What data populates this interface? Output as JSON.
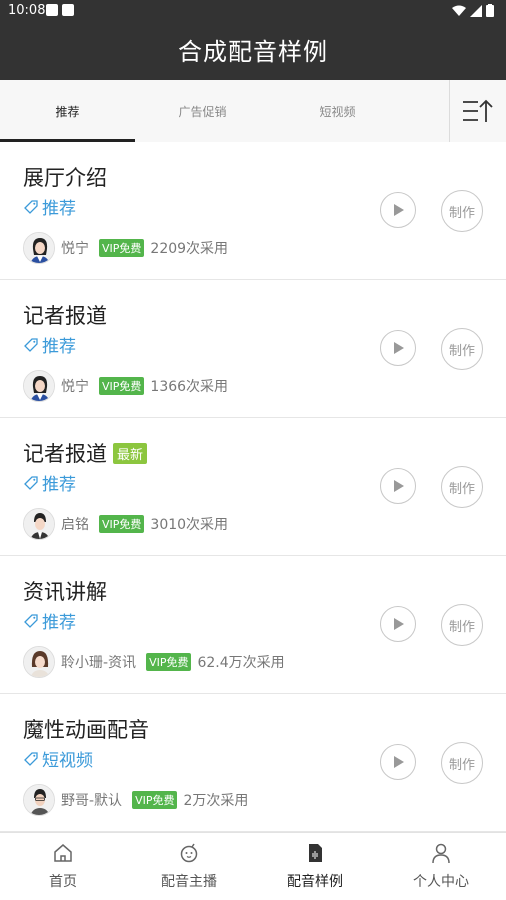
{
  "status_bar": {
    "time": "10:08"
  },
  "header": {
    "title": "合成配音样例"
  },
  "tabs": [
    {
      "label": "推荐",
      "active": true
    },
    {
      "label": "广告促销",
      "active": false
    },
    {
      "label": "短视频",
      "active": false
    }
  ],
  "items": [
    {
      "title": "展厅介绍",
      "badge": "",
      "tag": "推荐",
      "voice": "悦宁",
      "vip": "VIP免费",
      "usage": "2209次采用",
      "make_label": "制作",
      "avatar": "female-avatar"
    },
    {
      "title": "记者报道",
      "badge": "",
      "tag": "推荐",
      "voice": "悦宁",
      "vip": "VIP免费",
      "usage": "1366次采用",
      "make_label": "制作",
      "avatar": "female-avatar"
    },
    {
      "title": "记者报道",
      "badge": "最新",
      "tag": "推荐",
      "voice": "启铭",
      "vip": "VIP免费",
      "usage": "3010次采用",
      "make_label": "制作",
      "avatar": "male-avatar"
    },
    {
      "title": "资讯讲解",
      "badge": "",
      "tag": "推荐",
      "voice": "聆小珊-资讯",
      "vip": "VIP免费",
      "usage": "62.4万次采用",
      "make_label": "制作",
      "avatar": "female-avatar"
    },
    {
      "title": "魔性动画配音",
      "badge": "",
      "tag": "短视频",
      "voice": "野哥-默认",
      "vip": "VIP免费",
      "usage": "2万次采用",
      "make_label": "制作",
      "avatar": "male-avatar"
    }
  ],
  "bottom_nav": [
    {
      "label": "首页",
      "icon": "home-icon",
      "active": false
    },
    {
      "label": "配音主播",
      "icon": "robot-icon",
      "active": false
    },
    {
      "label": "配音样例",
      "icon": "document-icon",
      "active": true
    },
    {
      "label": "个人中心",
      "icon": "person-icon",
      "active": false
    }
  ],
  "colors": {
    "header_bg": "#333333",
    "tag_blue": "#3b9ad9",
    "vip_green": "#53b54b",
    "new_green": "#8cc63f"
  }
}
